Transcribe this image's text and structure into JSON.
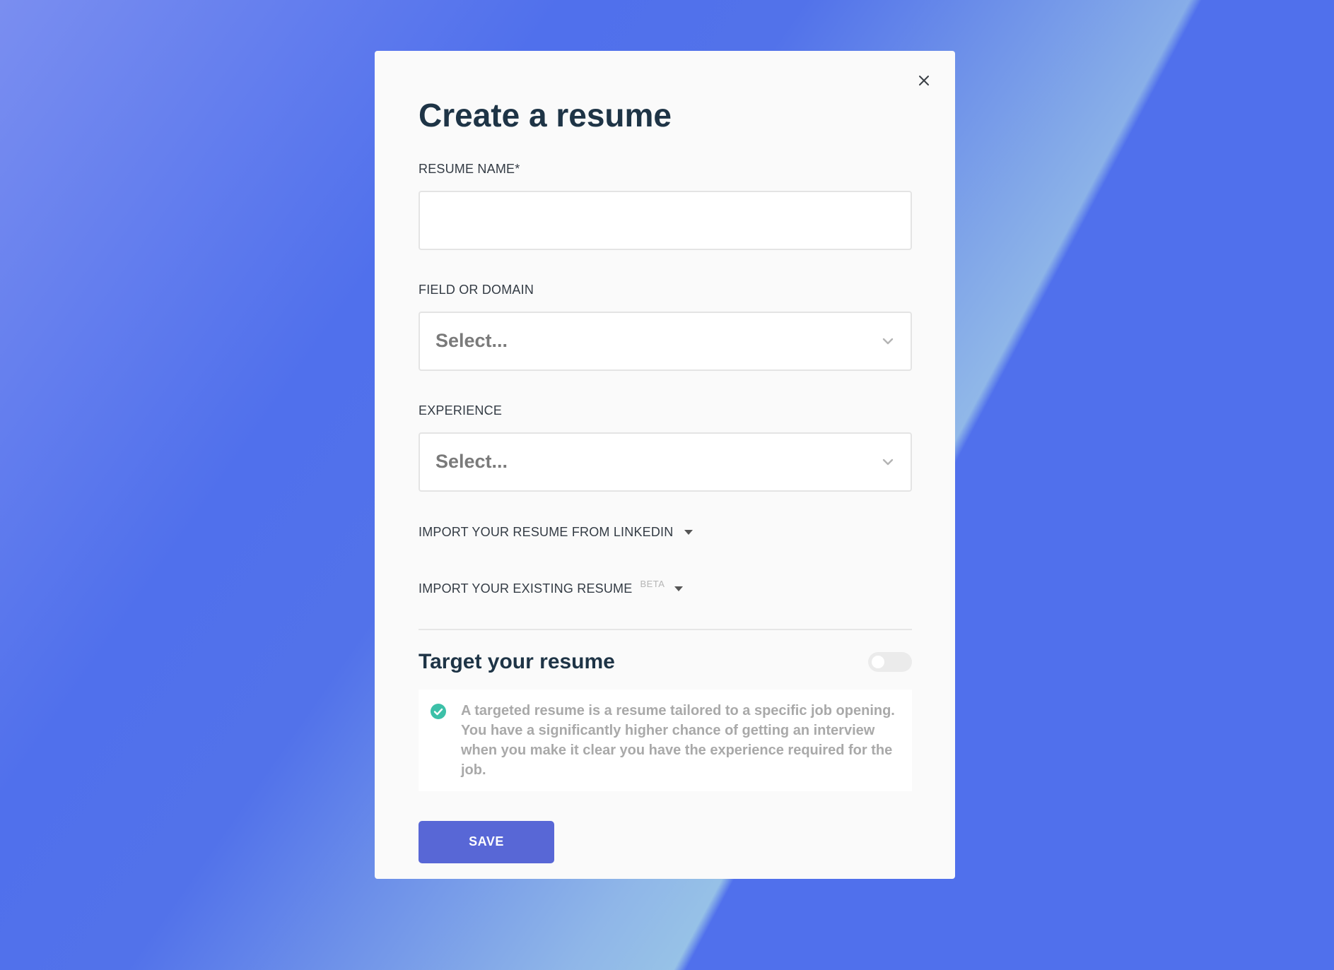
{
  "modal": {
    "title": "Create a resume",
    "close_icon": "close-icon"
  },
  "fields": {
    "resume_name": {
      "label": "RESUME NAME*",
      "value": "",
      "placeholder": ""
    },
    "field_or_domain": {
      "label": "FIELD OR DOMAIN",
      "placeholder": "Select...",
      "icon": "chevron-down-icon"
    },
    "experience": {
      "label": "EXPERIENCE",
      "placeholder": "Select...",
      "icon": "chevron-down-icon"
    }
  },
  "imports": {
    "linkedin": {
      "label": "IMPORT YOUR RESUME FROM LINKEDIN",
      "icon": "caret-down-icon"
    },
    "existing": {
      "label": "IMPORT YOUR EXISTING RESUME",
      "badge": "BETA",
      "icon": "caret-down-icon"
    }
  },
  "target": {
    "title": "Target your resume",
    "toggle_on": false,
    "info_icon": "check-circle-icon",
    "info_text": "A targeted resume is a resume tailored to a specific job opening. You have a significantly higher chance of getting an interview when you make it clear you have the experience required for the job."
  },
  "actions": {
    "save_label": "SAVE"
  },
  "colors": {
    "background": "#5070ec",
    "title": "#1e3446",
    "primary_button": "#5867d6",
    "check": "#3cc0a8",
    "info_text": "#a9a9a9"
  }
}
